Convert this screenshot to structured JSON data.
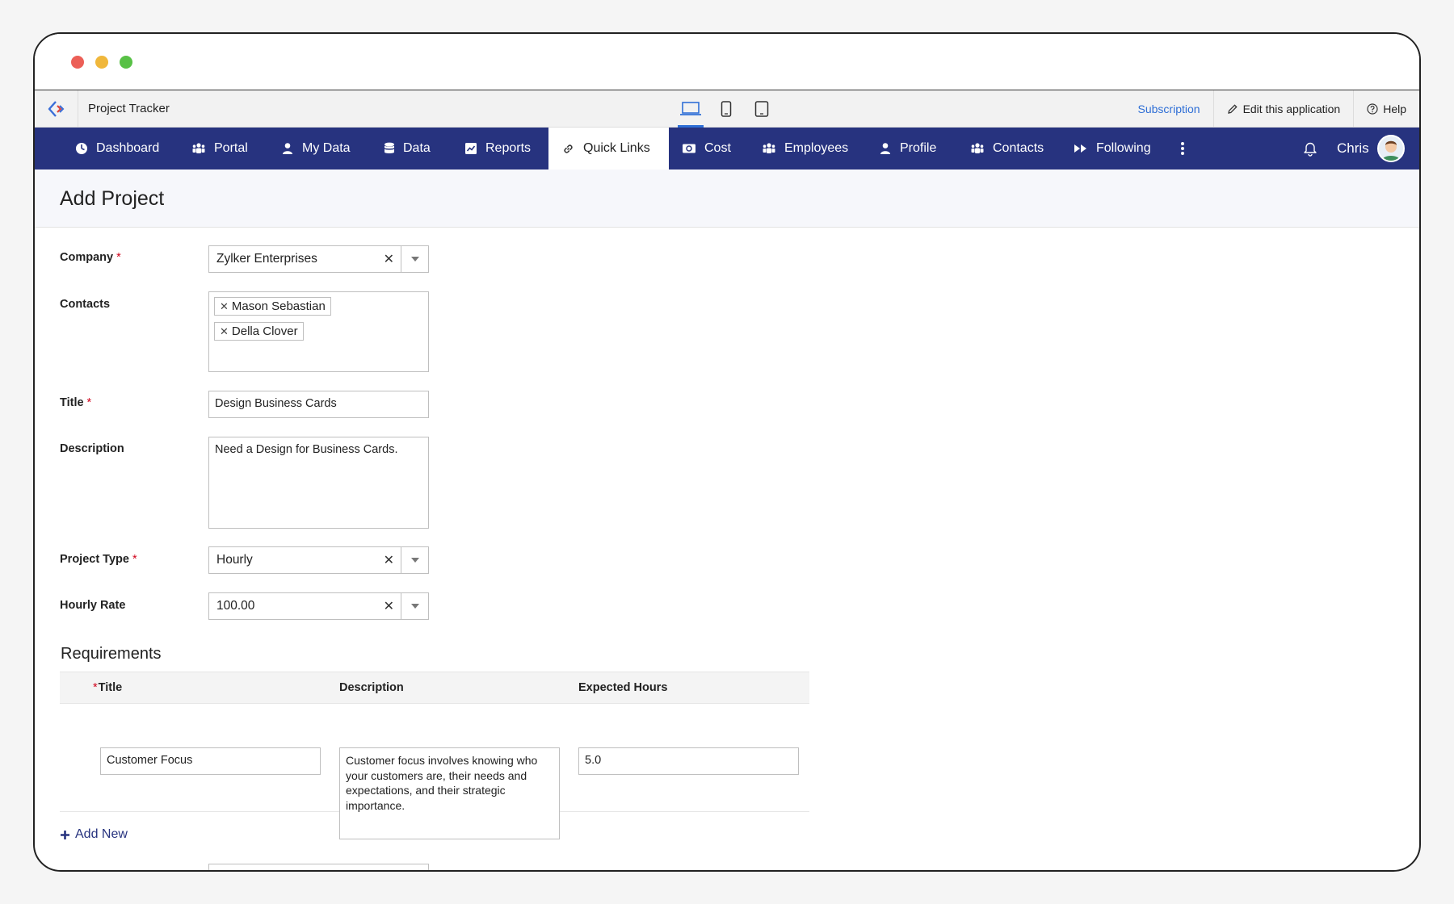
{
  "app": {
    "title": "Project Tracker",
    "subscription": "Subscription",
    "edit_app": "Edit this application",
    "help": "Help"
  },
  "nav": {
    "items": [
      "Dashboard",
      "Portal",
      "My Data",
      "Data",
      "Reports",
      "Quick Links",
      "Cost",
      "Employees",
      "Profile",
      "Contacts",
      "Following"
    ],
    "active": "Quick Links",
    "user": "Chris"
  },
  "page": {
    "title": "Add Project"
  },
  "form": {
    "company": {
      "label": "Company",
      "value": "Zylker Enterprises"
    },
    "contacts": {
      "label": "Contacts",
      "chips": [
        "Mason Sebastian",
        "Della Clover"
      ]
    },
    "title": {
      "label": "Title",
      "value": "Design Business Cards"
    },
    "description": {
      "label": "Description",
      "value": "Need a Design for Business Cards."
    },
    "project_type": {
      "label": "Project Type",
      "value": "Hourly"
    },
    "hourly_rate": {
      "label": "Hourly Rate",
      "value": "100.00"
    }
  },
  "requirements": {
    "title": "Requirements",
    "columns": [
      "Title",
      "Description",
      "Expected Hours"
    ],
    "rows": [
      {
        "title": "Customer Focus",
        "description": "Customer focus involves knowing who your customers are, their needs and expectations, and their strategic importance.",
        "hours": "5.0"
      }
    ],
    "add_new": "Add New"
  },
  "colors": {
    "nav_bg": "#27337f",
    "accent": "#2f6fd6",
    "required": "#d0021b"
  }
}
